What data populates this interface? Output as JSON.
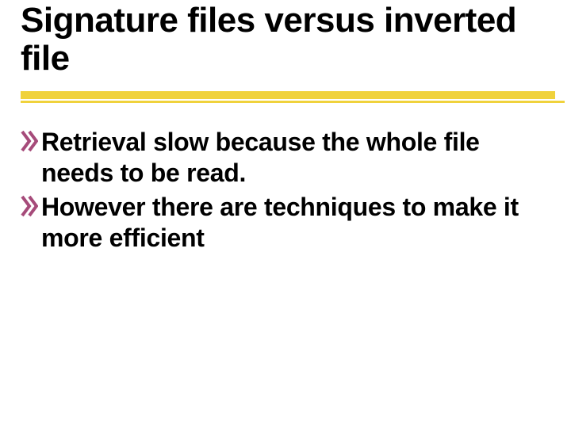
{
  "title": "Signature files versus inverted file",
  "bullets": [
    {
      "text": "Retrieval slow because the whole file needs to be read."
    },
    {
      "text": "However there are techniques to make it more efficient"
    }
  ],
  "colors": {
    "underline": "#f0d23c",
    "bullet": "#a64b7a"
  }
}
